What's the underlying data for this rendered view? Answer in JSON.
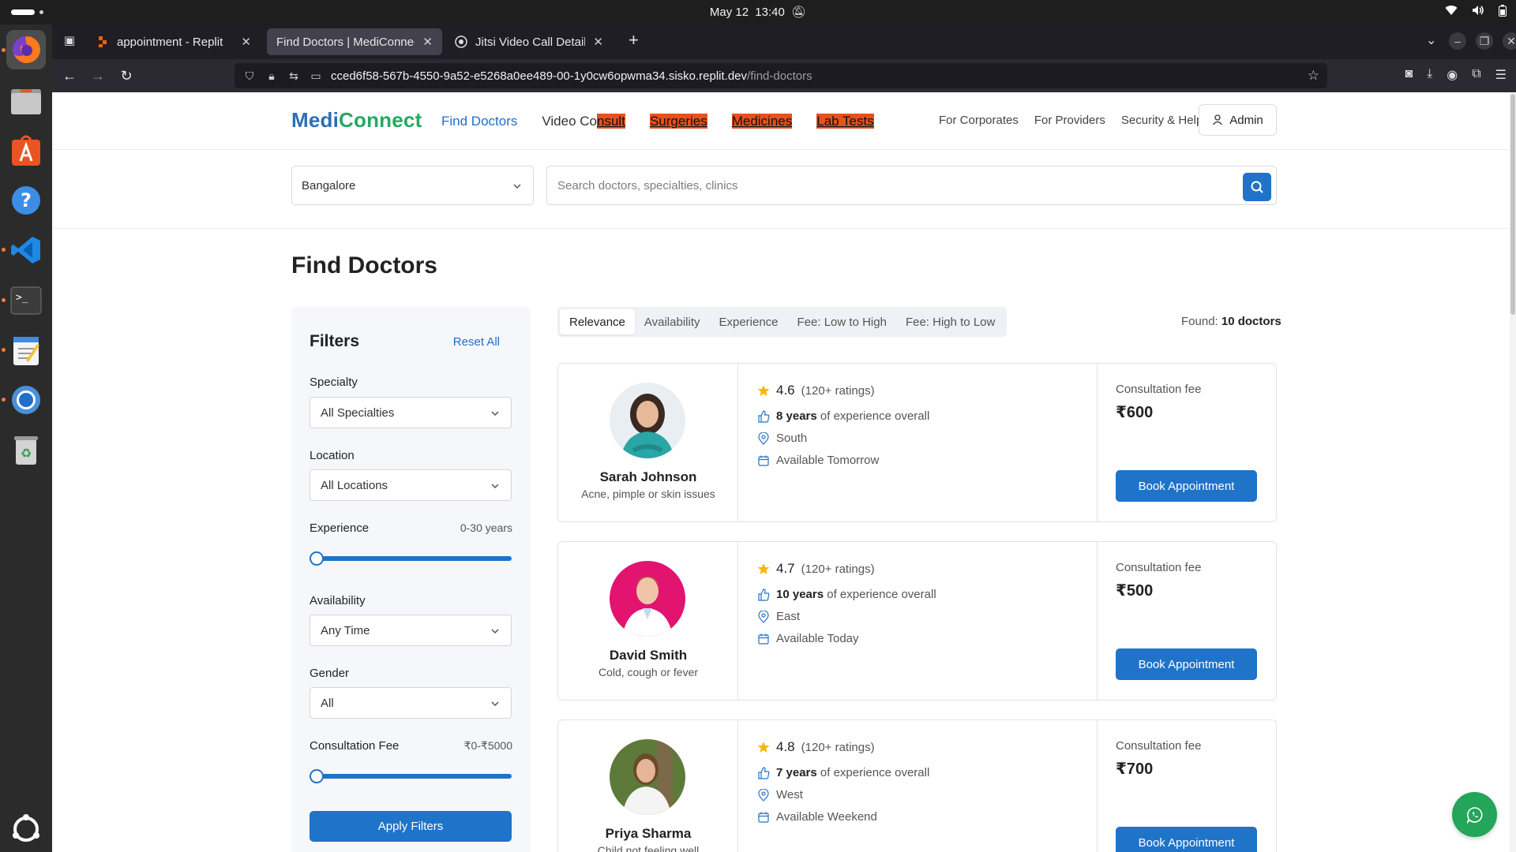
{
  "system": {
    "date": "May 12",
    "time": "13:40"
  },
  "browser": {
    "tabs": [
      {
        "title": "appointment - Replit",
        "active": false
      },
      {
        "title": "Find Doctors | MediConnect",
        "active": true
      },
      {
        "title": "Jitsi Video Call Details",
        "active": false
      }
    ],
    "url_host": "cced6f58-567b-4550-9a52-e5268a0ee489-00-1y0cw6opwma34.sisko.replit.dev",
    "url_path": "/find-doctors"
  },
  "site": {
    "logo_part1": "Medi",
    "logo_part2": "Connect",
    "nav": {
      "find_doctors": "Find Doctors",
      "video_consult_a": "Video Co",
      "video_consult_b": "nsult",
      "surgeries": "Surgeries",
      "medicines": "Medicines",
      "lab_tests": "Lab Tests"
    },
    "top_links": [
      "For Corporates",
      "For Providers",
      "Security & Help"
    ],
    "admin_label": "Admin"
  },
  "search": {
    "city": "Bangalore",
    "placeholder": "Search doctors, specialties, clinics"
  },
  "page_title": "Find Doctors",
  "filters": {
    "title": "Filters",
    "reset_label": "Reset All",
    "specialty_label": "Specialty",
    "specialty_value": "All Specialties",
    "location_label": "Location",
    "location_value": "All Locations",
    "experience_label": "Experience",
    "experience_range": "0-30 years",
    "experience_level": 0,
    "availability_label": "Availability",
    "availability_value": "Any Time",
    "gender_label": "Gender",
    "gender_value": "All",
    "fee_label": "Consultation Fee",
    "fee_range": "₹0-₹5000",
    "fee_level": 0,
    "apply_label": "Apply Filters"
  },
  "sort": {
    "options": [
      "Relevance",
      "Availability",
      "Experience",
      "Fee: Low to High",
      "Fee: High to Low"
    ],
    "active": "Relevance"
  },
  "found": {
    "label": "Found:",
    "value": "10 doctors"
  },
  "fee_label": "Consultation fee",
  "book_label": "Book Appointment",
  "experience_suffix": "of experience overall",
  "doctors": [
    {
      "name": "Sarah Johnson",
      "specialty": "Acne, pimple or skin issues",
      "rating": "4.6",
      "ratings_count": "(120+ ratings)",
      "experience": "8 years",
      "location": "South",
      "availability": "Available Tomorrow",
      "fee": "₹600"
    },
    {
      "name": "David Smith",
      "specialty": "Cold, cough or fever",
      "rating": "4.7",
      "ratings_count": "(120+ ratings)",
      "experience": "10 years",
      "location": "East",
      "availability": "Available Today",
      "fee": "₹500"
    },
    {
      "name": "Priya Sharma",
      "specialty": "Child not feeling well",
      "rating": "4.8",
      "ratings_count": "(120+ ratings)",
      "experience": "7 years",
      "location": "West",
      "availability": "Available Weekend",
      "fee": "₹700"
    }
  ],
  "colors": {
    "brand_blue": "#1f73c9",
    "brand_green": "#27a863",
    "highlight": "#e8501c",
    "whatsapp": "#23a55a"
  }
}
